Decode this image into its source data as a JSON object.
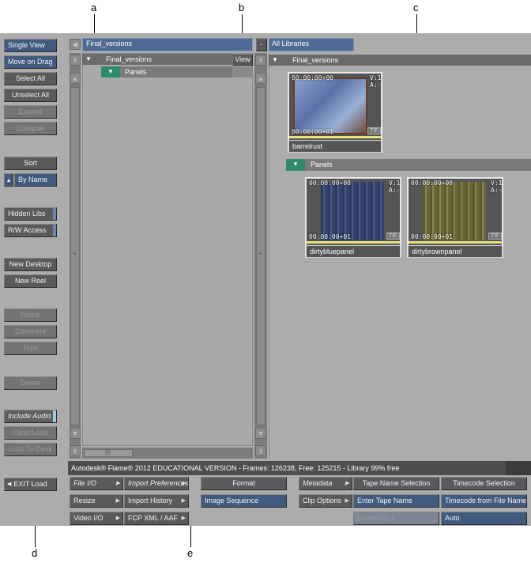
{
  "callouts": [
    "a",
    "b",
    "c",
    "d",
    "e"
  ],
  "left_panel": {
    "single_view": "Single View",
    "move_on_drag": "Move on Drag",
    "select_all": "Select All",
    "unselect_all": "Unselect All",
    "expand": "Expand",
    "collapse": "Collapse",
    "sort": "Sort",
    "by_name": "By Name",
    "hidden_libs": "Hidden Libs",
    "rw_access": "R/W Access",
    "new_desktop": "New Desktop",
    "new_reel": "New Reel",
    "name": "Name",
    "comment": "Comment",
    "tape": "Tape",
    "delete": "Delete",
    "include_audio": "Include Audio",
    "clear_load": "Clear/Load",
    "load_to_desk": "Load To Desk",
    "exit_load": "EXIT Load"
  },
  "left_browser": {
    "path": "Final_versions",
    "tree_item": "Final_versions",
    "view_button": "View",
    "subfolder": "Panels"
  },
  "right_browser": {
    "path": "All Libraries",
    "header": "Final_versions",
    "panels_header": "Panels",
    "clips": [
      {
        "name": "barrelrust",
        "tc_in": "00:00:00+00",
        "tc_out": "00:00:00+01",
        "va": "V:1",
        "aa": "A:-",
        "format": "TIF",
        "color": "#7a98c8"
      },
      {
        "name": "dirtybluepanel",
        "tc_in": "00:00:00+00",
        "tc_out": "00:00:00+01",
        "va": "V:1",
        "aa": "A:-",
        "format": "TIF",
        "color": "#3e4c74"
      },
      {
        "name": "dirtybrownpanel",
        "tc_in": "00:00:00+00",
        "tc_out": "00:00:00+01",
        "va": "V:1",
        "aa": "A:-",
        "format": "TIF",
        "color": "#706c3c"
      }
    ]
  },
  "status_bar": "Autodesk® Flame® 2012  EDUCATIONAL VERSION - Frames: 126238, Free: 125215 - Library 99% free",
  "bottom": {
    "file_io": "File I/O",
    "import_prefs": "Import Preferences",
    "resize": "Resize",
    "import_history": "Import History",
    "video_io": "Video I/O",
    "fcp_xml": "FCP XML / AAF",
    "format_label": "Format",
    "format_value": "Image Sequence",
    "metadata": "Metadata",
    "clip_options": "Clip Options",
    "tape_name_sel": "Tape Name Selection",
    "enter_tape_name": "Enter Tape Name",
    "levels_up": "Levels Up 1",
    "timecode_sel": "Timecode Selection",
    "timecode_from_file": "Timecode from File Name",
    "auto": "Auto"
  }
}
